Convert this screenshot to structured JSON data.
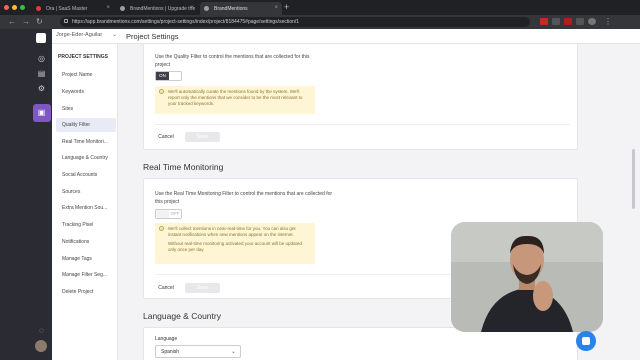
{
  "browser": {
    "tabs": [
      {
        "label": "Ora | SaaS Master",
        "icon_color": "#e53935"
      },
      {
        "label": "BrandMentions | Upgrade the",
        "icon_color": "#9e9e9e"
      },
      {
        "label": "BrandMentions",
        "icon_color": "#9e9e9e"
      }
    ],
    "url": "https://app.brandmentions.com/settings/project-settings/index/project/8184475#page/settings/section/1"
  },
  "project_selector": {
    "value": "Jorge-Eder-Aguilar"
  },
  "page_title": "Project Settings",
  "settings_nav": {
    "heading": "PROJECT SETTINGS",
    "items": [
      {
        "label": "Project Name"
      },
      {
        "label": "Keywords"
      },
      {
        "label": "Sites"
      },
      {
        "label": "Quality Filter"
      },
      {
        "label": "Real Time Monitori..."
      },
      {
        "label": "Language & Country"
      },
      {
        "label": "Social Accounts"
      },
      {
        "label": "Sources"
      },
      {
        "label": "Extra Mention Sou..."
      },
      {
        "label": "Tracking Pixel"
      },
      {
        "label": "Notifications"
      },
      {
        "label": "Manage Tags"
      },
      {
        "label": "Manage Filter Seg..."
      },
      {
        "label": "Delete Project"
      }
    ],
    "active_index": 3
  },
  "quality_filter": {
    "description": "Use the Quality Filter to control the mentions that are collected for this project",
    "toggle_on": "ON",
    "notice": "We'll automatically curate the mentions found by the system. We'll report only the mentions that we consider to be the most relevant to your tracked keywords.",
    "cancel": "Cancel",
    "save": "Save"
  },
  "real_time": {
    "title": "Real Time Monitoring",
    "description": "Use the Real Time Monitoring Filter to control the mentions that are collected for this project",
    "toggle_off": "OFF",
    "notice_1": "We'll collect mentions in near-real-time for you. You can also get instant notifications when new mentions appear on the internet.",
    "notice_2": "Without real-time monitoring activated your account will be updated only once per day.",
    "cancel": "Cancel",
    "save": "Save"
  },
  "language_country": {
    "title": "Language & Country",
    "language_label": "Language",
    "language_value": "Spanish"
  },
  "colors": {
    "accent": "#7e57c2",
    "notice_bg": "#fdf5d4",
    "chat": "#2a83e6"
  }
}
